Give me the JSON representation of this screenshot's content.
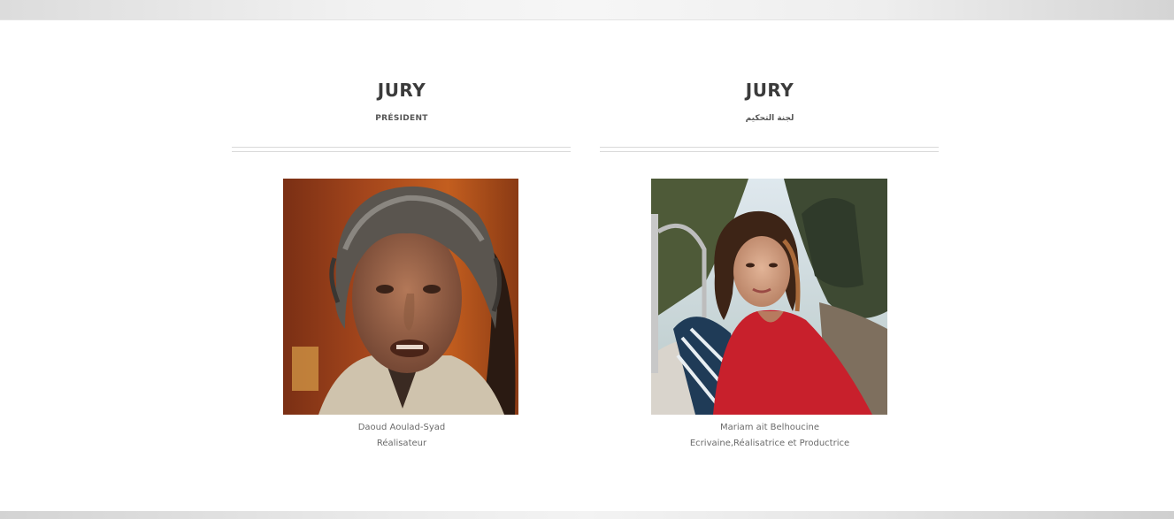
{
  "jury_left": {
    "title": "JURY",
    "subtitle": "PRÉSIDENT",
    "member": {
      "name": "Daoud Aoulad-Syad",
      "role": "Réalisateur"
    }
  },
  "jury_right": {
    "title": "JURY",
    "subtitle": "لجنة التحكيم",
    "member": {
      "name": "Mariam ait Belhoucine",
      "role": "Ecrivaine,Réalisatrice et Productrice"
    }
  },
  "colors": {
    "heading": "#3b3b3b",
    "subheading": "#555555",
    "caption": "#6a6a6a",
    "divider": "#d9d9d9"
  }
}
